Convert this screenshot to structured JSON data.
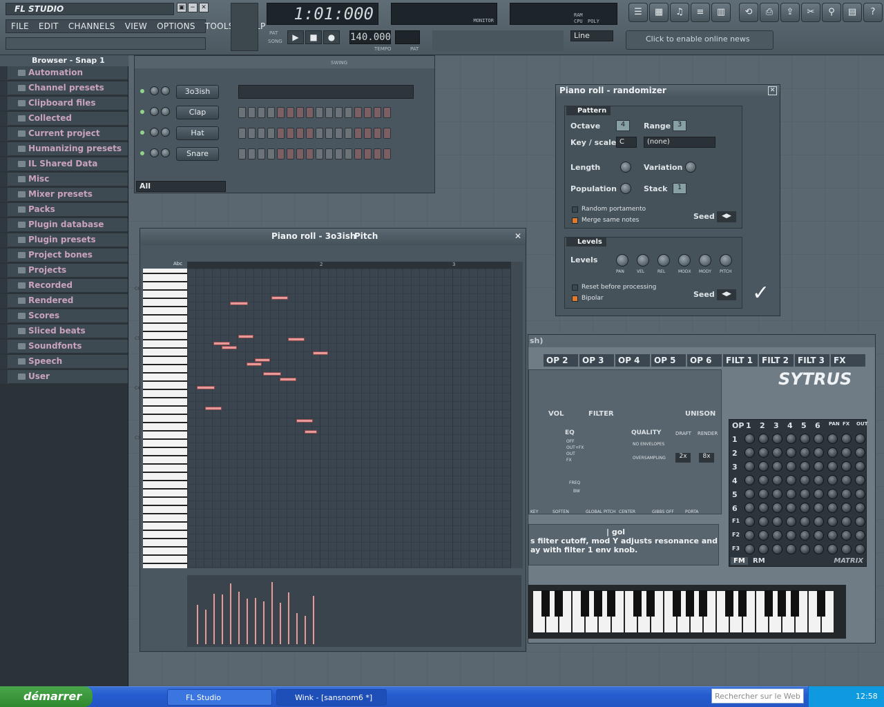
{
  "app": {
    "logo": "FL STUDIO",
    "window_buttons": [
      "▣",
      "−",
      "✕"
    ]
  },
  "menu": [
    "FILE",
    "EDIT",
    "CHANNELS",
    "VIEW",
    "OPTIONS",
    "TOOLS",
    "HELP"
  ],
  "transport": {
    "time": "1:01:000",
    "tempo": "140.000",
    "tempo_label": "TEMPO",
    "pat_label": "PAT",
    "song_label": "SONG",
    "pattern_label": "PAT",
    "snap": "Line",
    "monitor_label": "MONITOR",
    "cpu_label": "CPU",
    "poly_label": "POLY",
    "ram_label": "RAM"
  },
  "news": "Click to enable online news",
  "browser": {
    "title": "Browser - Snap 1",
    "items": [
      "Automation",
      "Channel presets",
      "Clipboard files",
      "Collected",
      "Current project",
      "Humanizing presets",
      "IL Shared Data",
      "Misc",
      "Mixer presets",
      "Packs",
      "Plugin database",
      "Plugin presets",
      "Project bones",
      "Projects",
      "Recorded",
      "Rendered",
      "Scores",
      "Sliced beats",
      "Soundfonts",
      "Speech",
      "User"
    ]
  },
  "step_seq": {
    "swing_label": "SWING",
    "channels": [
      "3o3ish",
      "Clap",
      "Hat",
      "Snare"
    ],
    "filter": "All"
  },
  "piano_roll": {
    "title": "Piano roll - 3o3ish",
    "target": "Pitch",
    "bars": [
      "2",
      "3"
    ],
    "octaves": [
      "C6",
      "C5",
      "C4",
      "C3"
    ],
    "abc": "Abc"
  },
  "randomizer": {
    "title": "Piano roll - randomizer",
    "pattern": "Pattern",
    "octave_label": "Octave",
    "octave": "4",
    "range_label": "Range",
    "range": "3",
    "keyscale_label": "Key / scale",
    "key": "C",
    "scale": "(none)",
    "length_label": "Length",
    "variation_label": "Variation",
    "population_label": "Population",
    "stack_label": "Stack",
    "stack": "1",
    "random_portamento": "Random portamento",
    "merge_same_notes": "Merge same notes",
    "seed_label": "Seed",
    "levels_group": "Levels",
    "levels_label": "Levels",
    "level_knobs": [
      "PAN",
      "VEL",
      "REL",
      "MODX",
      "MODY",
      "PITCH"
    ],
    "reset_before": "Reset before processing",
    "bipolar": "Bipolar"
  },
  "sytrus": {
    "title": "sh)",
    "tabs": [
      "OP 2",
      "OP 3",
      "OP 4",
      "OP 5",
      "OP 6",
      "FILT 1",
      "FILT 2",
      "FILT 3",
      "FX"
    ],
    "logo": "SYTRUS",
    "matrix_head": [
      "OP",
      "1",
      "2",
      "3",
      "4",
      "5",
      "6",
      "PAN",
      "FX",
      "OUT"
    ],
    "matrix_rows": [
      "1",
      "2",
      "3",
      "4",
      "5",
      "6",
      "F1",
      "F2",
      "F3"
    ],
    "fm": "FM",
    "rm": "RM",
    "matrix": "MATRIX",
    "vol": "VOL",
    "filter": "FILTER",
    "unison": "UNISON",
    "quality": "QUALITY",
    "draft": "DRAFT",
    "render": "RENDER",
    "no_envelopes": "NO ENVELOPES",
    "oversampling": "OVERSAMPLING",
    "os1": "2x",
    "os2": "8x",
    "eq": "EQ",
    "eq_opts": [
      "OFF",
      "OUT+FX",
      "OUT",
      "FX"
    ],
    "freq": "FREQ",
    "bw": "BW",
    "flags": [
      "SOFTEN",
      "GLOBAL PITCH",
      "CENTER",
      "GIBBS OFF",
      "PORTA"
    ],
    "key": "KEY",
    "hint_title": "| gol",
    "hint_line1": "s filter cutoff, mod Y adjusts resonance and",
    "hint_line2": "ay with filter 1 env knob."
  },
  "taskbar": {
    "start": "démarrer",
    "tasks": [
      "FL Studio",
      "Wink - [sansnom6 *]"
    ],
    "search": "Rechercher sur le Web",
    "clock": "12:58"
  }
}
